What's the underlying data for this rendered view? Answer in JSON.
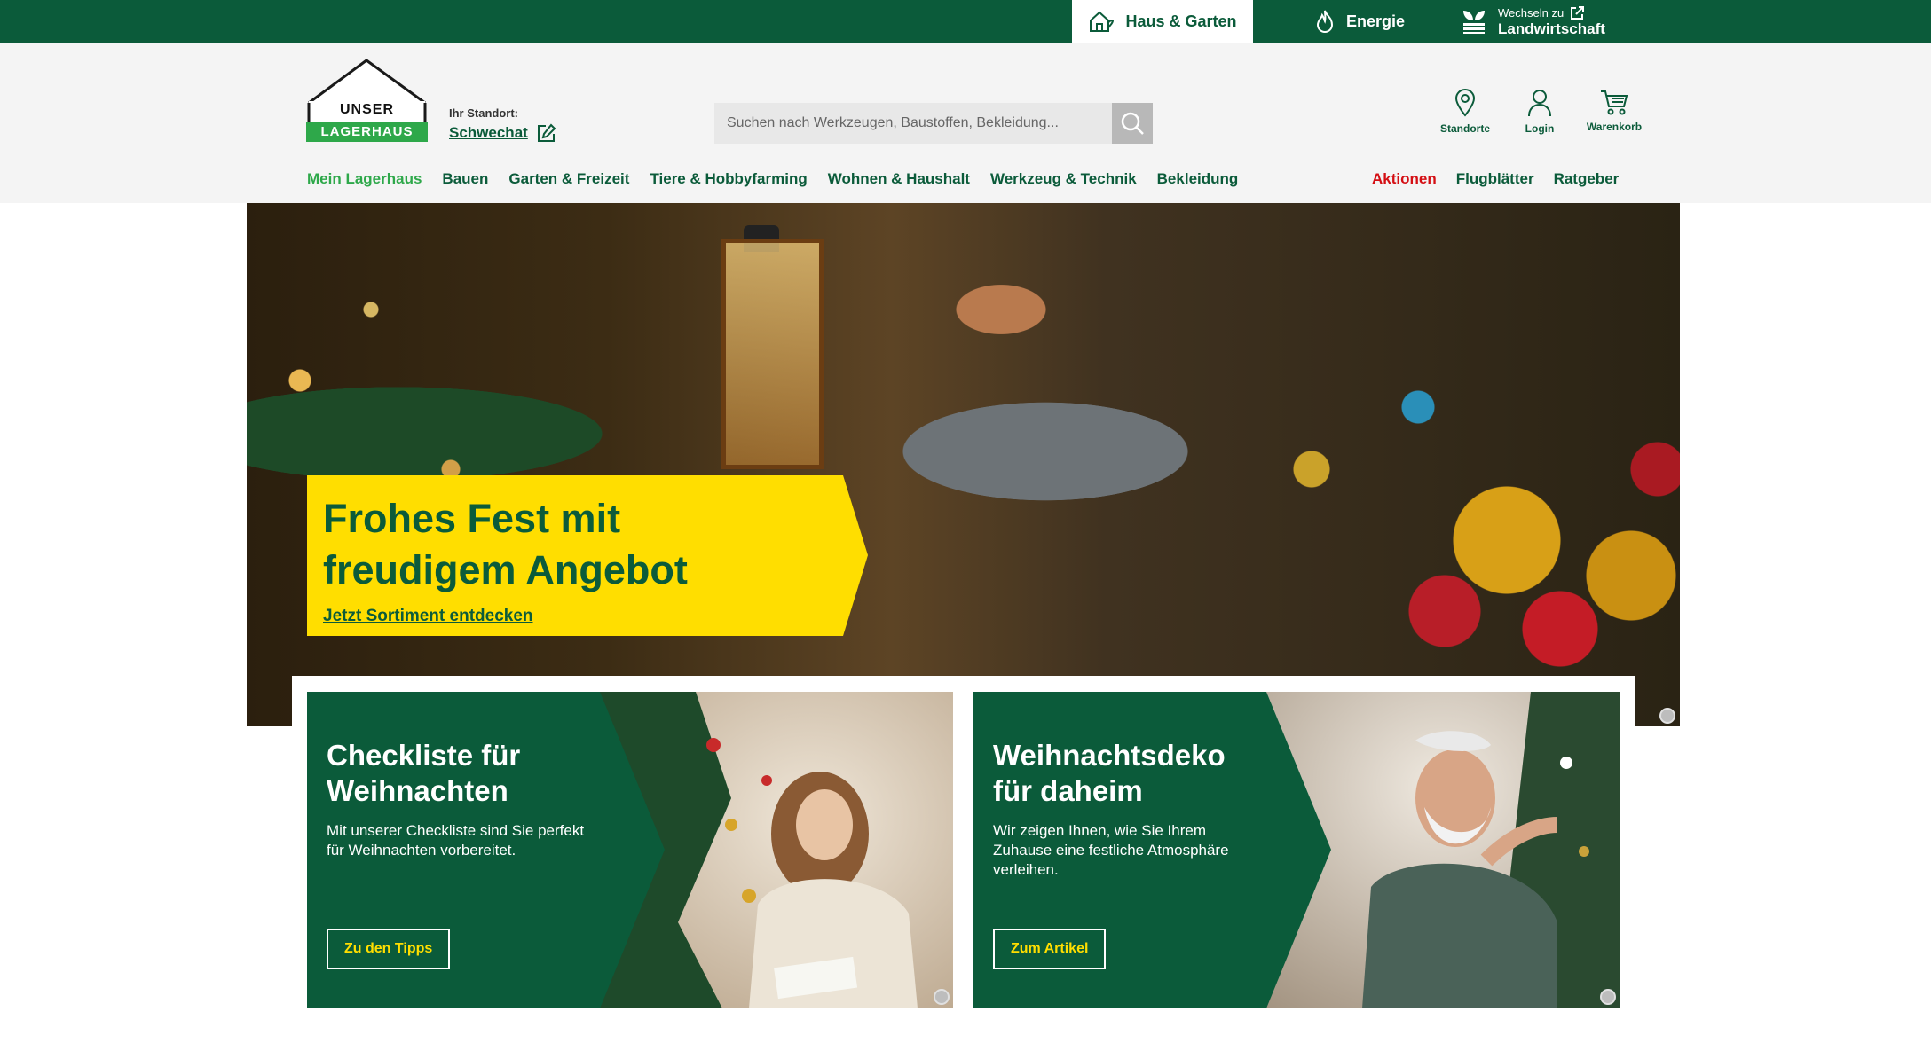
{
  "topbar": {
    "haus_garten": "Haus & Garten",
    "energie": "Energie",
    "wechseln": "Wechseln zu",
    "landwirtschaft": "Landwirtschaft"
  },
  "logo": {
    "line1": "UNSER",
    "line2": "LAGERHAUS"
  },
  "standort": {
    "label": "Ihr Standort:",
    "city": "Schwechat"
  },
  "search": {
    "placeholder": "Suchen nach Werkzeugen, Baustoffen, Bekleidung..."
  },
  "header_icons": {
    "standorte": "Standorte",
    "login": "Login",
    "warenkorb": "Warenkorb"
  },
  "nav": {
    "items": [
      "Mein Lagerhaus",
      "Bauen",
      "Garten & Freizeit",
      "Tiere & Hobbyfarming",
      "Wohnen & Haushalt",
      "Werkzeug & Technik",
      "Bekleidung"
    ],
    "right": [
      "Aktionen",
      "Flugblätter",
      "Ratgeber"
    ]
  },
  "hero": {
    "title_line1": "Frohes Fest mit",
    "title_line2": "freudigem Angebot",
    "link": "Jetzt Sortiment entdecken"
  },
  "cards": [
    {
      "title_line1": "Checkliste für",
      "title_line2": "Weihnachten",
      "text": "Mit unserer Checkliste sind Sie perfekt für Weihnachten vorbereitet.",
      "cta": "Zu den Tipps"
    },
    {
      "title_line1": "Weihnachtsdeko",
      "title_line2": "für daheim",
      "text": "Wir zeigen Ihnen, wie Sie Ihrem Zuhause eine festliche Atmosphäre verleihen.",
      "cta": "Zum Artikel"
    }
  ],
  "colors": {
    "brand_green": "#0b5b3a",
    "accent_yellow": "#ffde00",
    "active_green": "#2ea84a",
    "sale_red": "#d40f14"
  },
  "icons": [
    "house-garden-icon",
    "flame-icon",
    "sprout-icon",
    "external-link-icon",
    "edit-icon",
    "search-icon",
    "location-pin-icon",
    "user-icon",
    "cart-icon"
  ]
}
